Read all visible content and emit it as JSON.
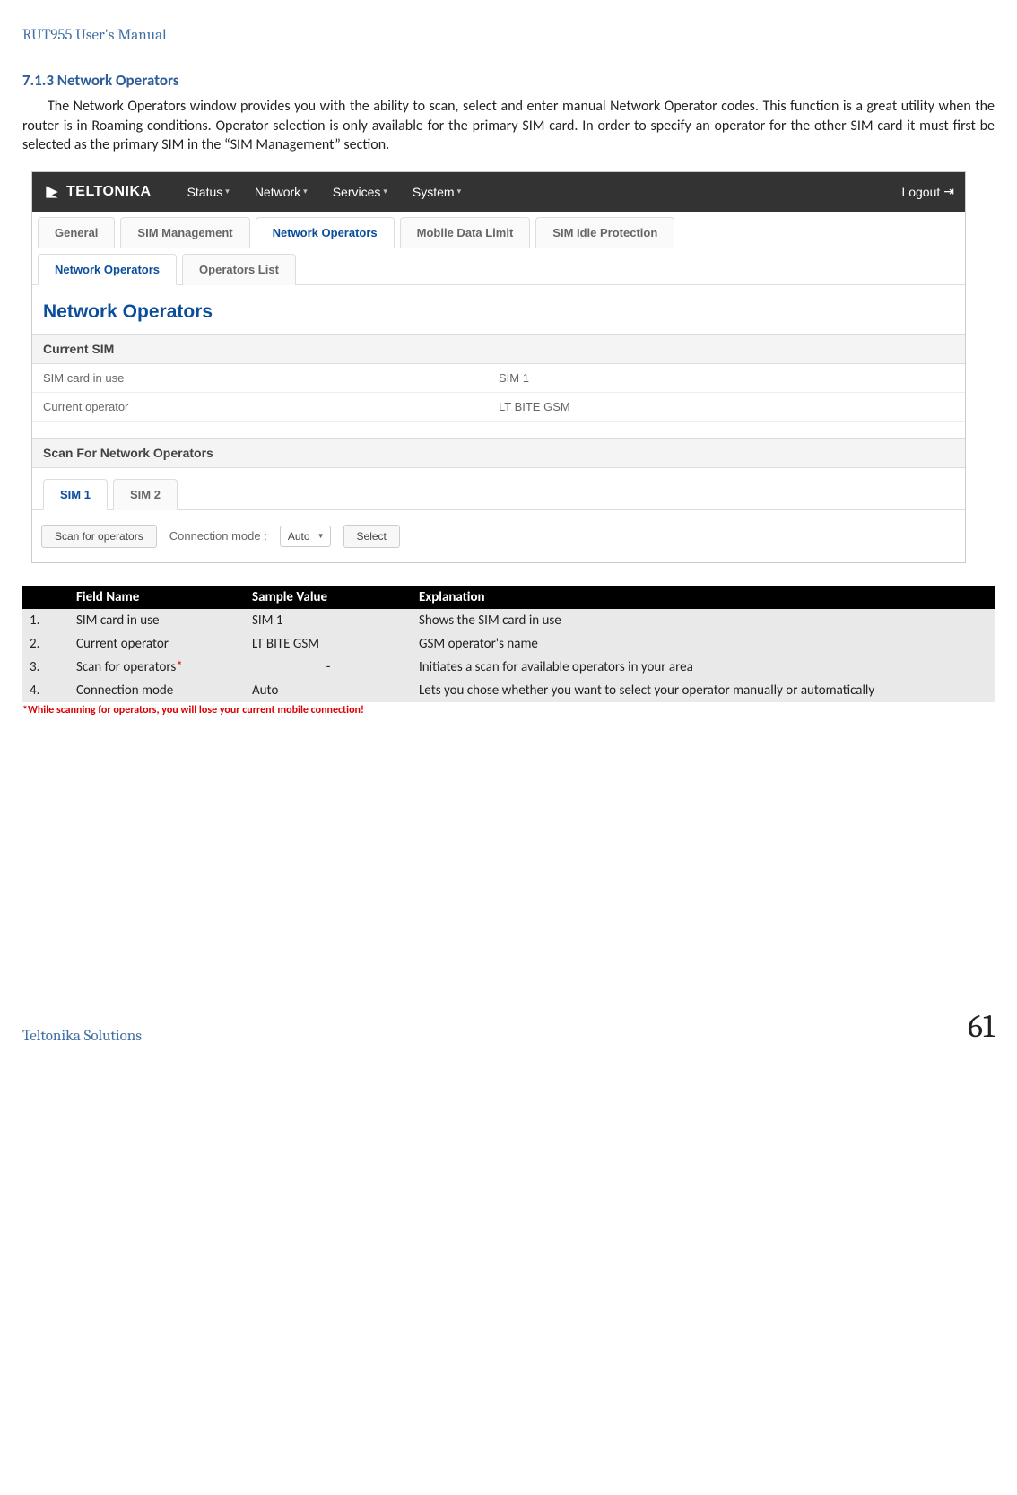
{
  "doc_header": "RUT955 User's Manual",
  "section_number": "7.1.3",
  "section_title": "Network Operators",
  "body_paragraph": "The Network Operators window provides you with the ability to scan, select and enter manual Network Operator codes. This function is a great utility when the router is in Roaming conditions. Operator selection is only available for the primary SIM card. In order to specify an operator for the other SIM card it must first be selected as the primary SIM in the “SIM Management” section.",
  "screenshot": {
    "logo": "TELTONIKA",
    "top_menu": [
      "Status",
      "Network",
      "Services",
      "System"
    ],
    "logout": "Logout",
    "tabs_main": [
      "General",
      "SIM Management",
      "Network Operators",
      "Mobile Data Limit",
      "SIM Idle Protection"
    ],
    "tabs_main_active": 2,
    "tabs_sub": [
      "Network Operators",
      "Operators List"
    ],
    "tabs_sub_active": 0,
    "page_heading": "Network Operators",
    "panel1_title": "Current SIM",
    "panel1_rows": [
      {
        "k": "SIM card in use",
        "v": "SIM 1"
      },
      {
        "k": "Current operator",
        "v": "LT BITE GSM"
      }
    ],
    "panel2_title": "Scan For Network Operators",
    "sim_tabs": [
      "SIM 1",
      "SIM 2"
    ],
    "sim_tab_active": 0,
    "scan_button": "Scan for operators",
    "conn_mode_label": "Connection mode :",
    "conn_mode_value": "Auto",
    "select_button": "Select"
  },
  "table": {
    "headers": [
      "",
      "Field Name",
      "Sample Value",
      "Explanation"
    ],
    "rows": [
      {
        "n": "1.",
        "field": "SIM card in use",
        "sample": "SIM 1",
        "expl": "Shows the SIM card in use",
        "star": false
      },
      {
        "n": "2.",
        "field": "Current operator",
        "sample": "LT BITE GSM",
        "expl": "GSM operator's name",
        "star": false
      },
      {
        "n": "3.",
        "field": "Scan for operators",
        "sample": "-",
        "expl": "Initiates a scan for available operators in your area",
        "star": true,
        "center_sample": true
      },
      {
        "n": "4.",
        "field": "Connection mode",
        "sample": "Auto",
        "expl": "Lets you chose whether you want to select your operator manually or automatically",
        "star": false
      }
    ]
  },
  "warning_text": "*While scanning for operators, you will lose your current mobile connection!",
  "footer_left": "Teltonika Solutions",
  "footer_right": "61",
  "chart_data": {
    "type": "table",
    "title": "Network Operators field descriptions",
    "columns": [
      "#",
      "Field Name",
      "Sample Value",
      "Explanation"
    ],
    "rows": [
      [
        "1.",
        "SIM card in use",
        "SIM 1",
        "Shows the SIM card in use"
      ],
      [
        "2.",
        "Current operator",
        "LT BITE GSM",
        "GSM operator's name"
      ],
      [
        "3.",
        "Scan for operators*",
        "-",
        "Initiates a scan for available operators in your area"
      ],
      [
        "4.",
        "Connection mode",
        "Auto",
        "Lets you chose whether you want to select your operator manually or automatically"
      ]
    ]
  }
}
